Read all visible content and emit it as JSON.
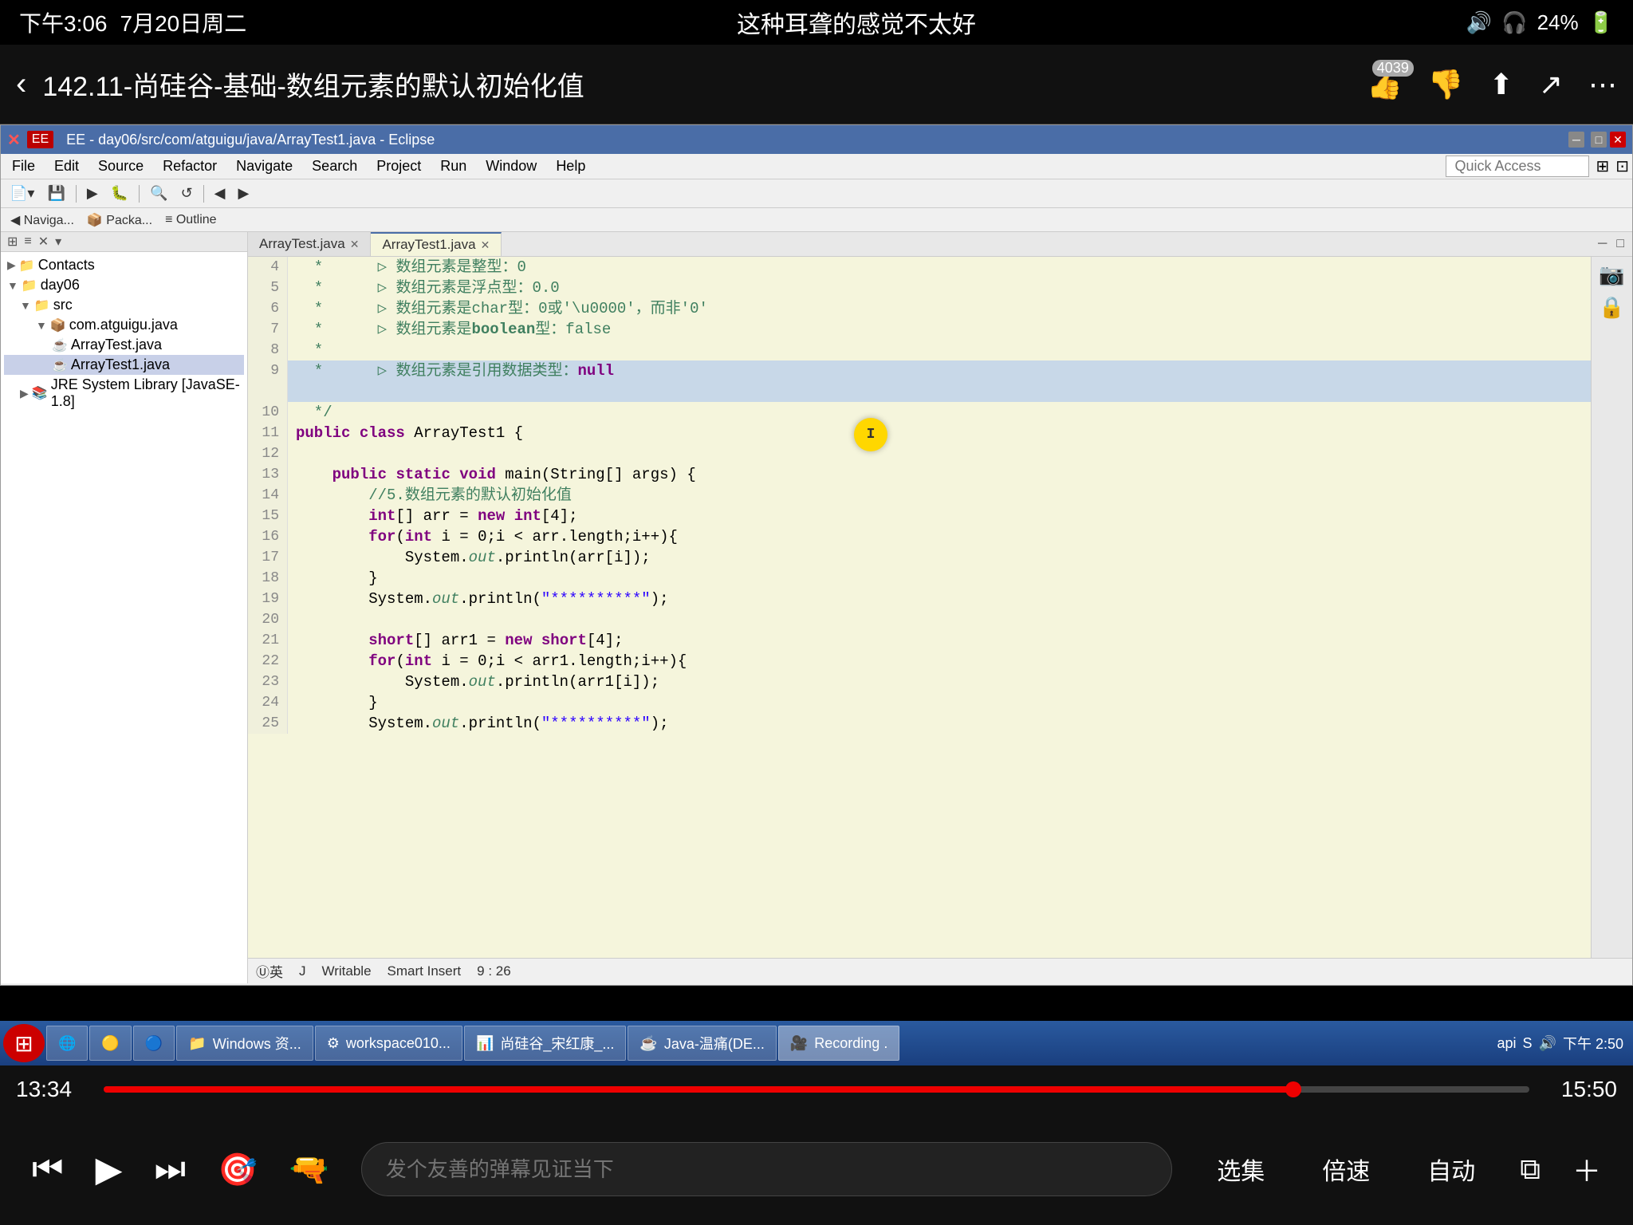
{
  "status_bar": {
    "time": "下午3:06",
    "date": "7月20日周二",
    "center_text": "这种耳聋的感觉不太好",
    "battery": "24%",
    "battery_icon": "🔋"
  },
  "video_header": {
    "title": "142.11-尚硅谷-基础-数组元素的默认初始化值",
    "like_count": "4039",
    "back_icon": "‹",
    "like_icon": "👍",
    "dislike_icon": "👎",
    "share_icon": "⬆",
    "forward_icon": "↗",
    "more_icon": "⋯"
  },
  "eclipse": {
    "title": "EE - day06/src/com/atguigu/java/ArrayTest1.java - Eclipse",
    "menu_items": [
      "File",
      "Edit",
      "Source",
      "Refactor",
      "Navigate",
      "Search",
      "Project",
      "Run",
      "Window",
      "Help"
    ],
    "quick_access": "Quick Access",
    "tabs": {
      "nav_label": "Naviga...",
      "package_label": "Packa...",
      "outline_label": "Outline"
    },
    "editor_tabs": [
      {
        "label": "ArrayTest.java",
        "active": false
      },
      {
        "label": "ArrayTest1.java",
        "active": true
      }
    ],
    "sidebar": {
      "items": [
        {
          "indent": 0,
          "label": "Contacts",
          "arrow": "▶",
          "icon": "📁"
        },
        {
          "indent": 0,
          "label": "day06",
          "arrow": "▼",
          "icon": "📁"
        },
        {
          "indent": 1,
          "label": "src",
          "arrow": "▼",
          "icon": "📁"
        },
        {
          "indent": 2,
          "label": "com.atguigu.java",
          "arrow": "▼",
          "icon": "📦"
        },
        {
          "indent": 3,
          "label": "ArrayTest.java",
          "arrow": "",
          "icon": "☕"
        },
        {
          "indent": 3,
          "label": "ArrayTest1.java",
          "arrow": "",
          "icon": "☕"
        },
        {
          "indent": 1,
          "label": "JRE System Library [JavaSE-1.8]",
          "arrow": "▶",
          "icon": "📚"
        }
      ]
    },
    "code_lines": [
      {
        "num": "4",
        "content": "  *      ▷ 数组元素是整型：0"
      },
      {
        "num": "5",
        "content": "  *      ▷ 数组元素是浮点型：0.0"
      },
      {
        "num": "6",
        "content": "  *      ▷ 数组元素是char型：0或'\\u0000'，而非'0'"
      },
      {
        "num": "7",
        "content": "  *      ▷ 数组元素是boolean型：false"
      },
      {
        "num": "8",
        "content": "  *"
      },
      {
        "num": "9",
        "content": "  *      ▷ 数组元素是引用数据类型：null"
      },
      {
        "num": "10",
        "content": "  */"
      },
      {
        "num": "11",
        "content": "public class ArrayTest1 {"
      },
      {
        "num": "12",
        "content": ""
      },
      {
        "num": "13",
        "content": "    public static void main(String[] args) {"
      },
      {
        "num": "14",
        "content": "        //5.数组元素的默认初始化值"
      },
      {
        "num": "15",
        "content": "        int[] arr = new int[4];"
      },
      {
        "num": "16",
        "content": "        for(int i = 0;i < arr.length;i++){"
      },
      {
        "num": "17",
        "content": "            System.out.println(arr[i]);"
      },
      {
        "num": "18",
        "content": "        }"
      },
      {
        "num": "19",
        "content": "        System.out.println(\"**********\");"
      },
      {
        "num": "20",
        "content": ""
      },
      {
        "num": "21",
        "content": "        short[] arr1 = new short[4];"
      },
      {
        "num": "22",
        "content": "        for(int i = 0;i < arr1.length;i++){"
      },
      {
        "num": "23",
        "content": "            System.out.println(arr1[i]);"
      },
      {
        "num": "24",
        "content": "        }"
      },
      {
        "num": "25",
        "content": "        System.out.println(\"**********\");"
      }
    ],
    "status": {
      "writable": "Writable",
      "insert": "Smart Insert",
      "position": "9 : 26"
    }
  },
  "taskbar": {
    "items": [
      {
        "label": "Windows 资...",
        "icon": "🗂"
      },
      {
        "label": "workspace010...",
        "icon": "⚙"
      },
      {
        "label": "尚硅谷_宋红康_...",
        "icon": "📊"
      },
      {
        "label": "Java-温痛(DE...",
        "icon": "☕"
      },
      {
        "label": "Recording ...",
        "icon": "🎥"
      }
    ],
    "time": "下午 2:50",
    "api_label": "api"
  },
  "progress": {
    "current": "13:34",
    "total": "15:50",
    "fill_percent": 84
  },
  "controls": {
    "skip_back": "⏮",
    "play": "▶",
    "skip_forward": "⏭",
    "comment_placeholder": "发个友善的弹幕见证当下",
    "select_label": "选集",
    "speed_label": "倍速",
    "auto_label": "自动",
    "pip_label": "⧉",
    "fullscreen_label": "＋"
  }
}
